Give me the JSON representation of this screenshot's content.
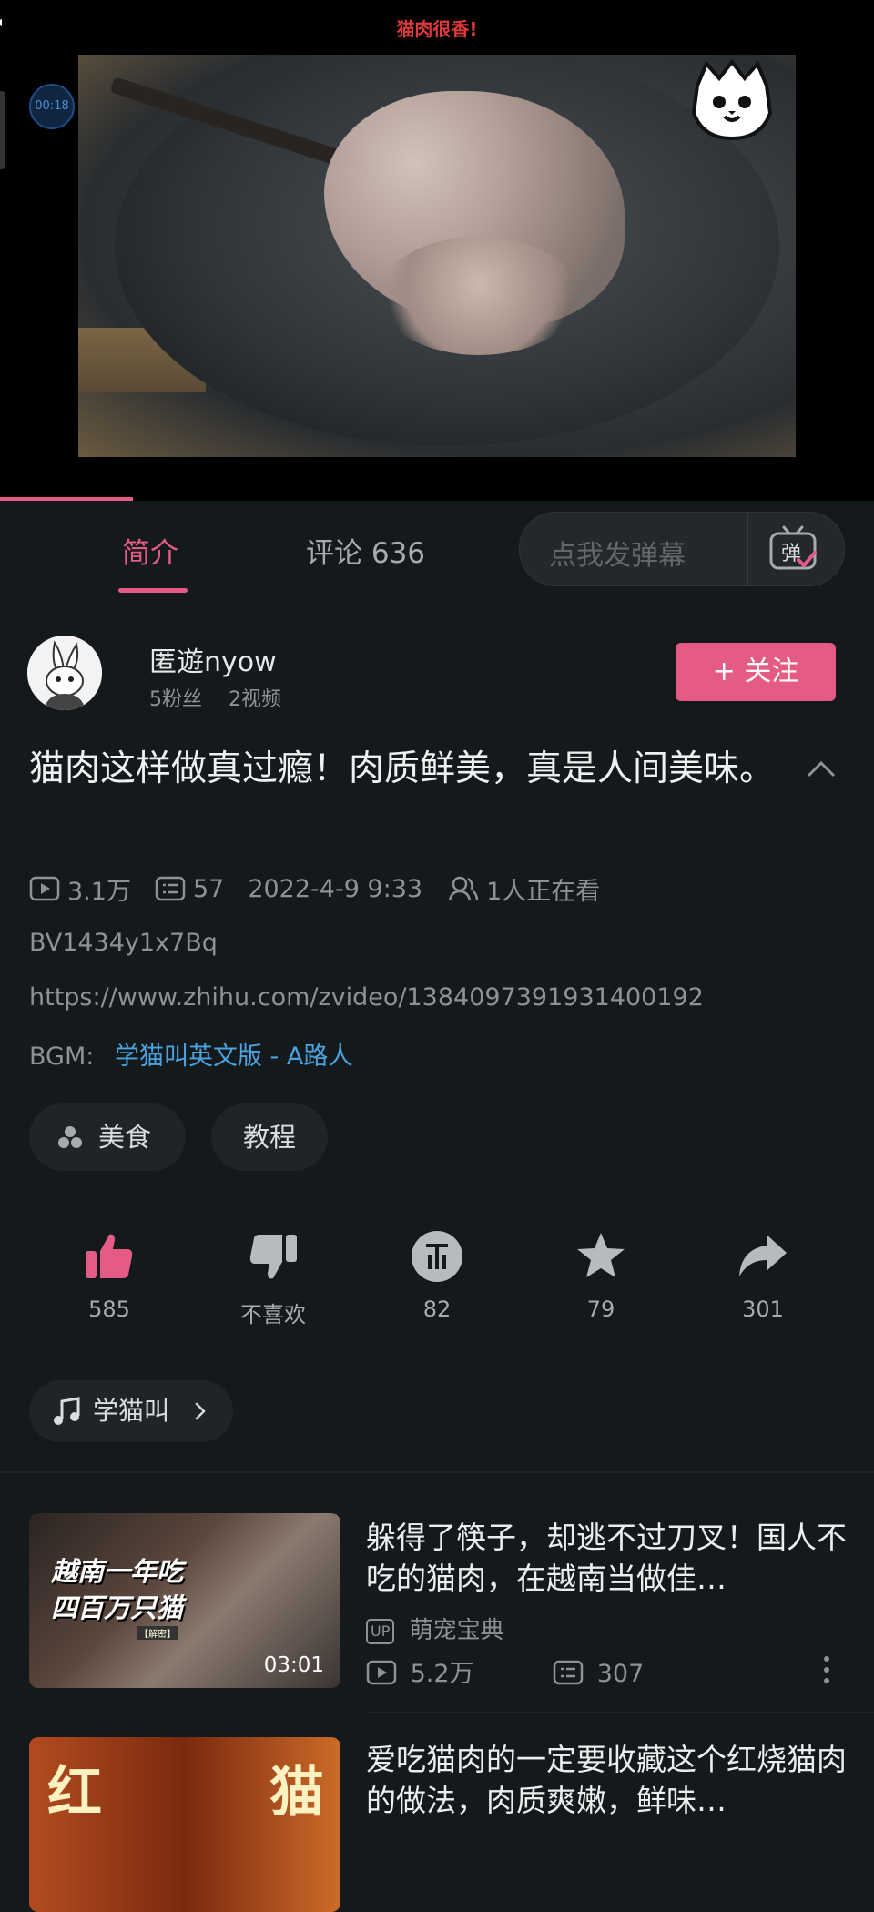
{
  "player": {
    "top_danmaku": "猫肉很香!",
    "time_badge": "00:18"
  },
  "tabs": {
    "intro": "简介",
    "comments": "评论 636",
    "danmaku_placeholder": "点我发弹幕",
    "danmaku_icon_glyph": "弹"
  },
  "uploader": {
    "name": "匿遊nyow",
    "stats": "5粉丝 　2视频",
    "follow_label": "+ 关注"
  },
  "video": {
    "title": "猫肉这样做真过瘾！肉质鲜美，真是人间美味。",
    "views": "3.1万",
    "danmaku_count": "57",
    "date": "2022-4-9 9:33",
    "watching": "1人正在看",
    "bvid": "BV1434y1x7Bq",
    "url": "https://www.zhihu.com/zvideo/1384097391931400192",
    "bgm_prefix": "BGM:",
    "bgm_link": "学猫叫英文版 - A路人"
  },
  "tags": {
    "food": "美食",
    "tutorial": "教程"
  },
  "actions": {
    "like": "585",
    "dislike": "不喜欢",
    "coin": "82",
    "favorite": "79",
    "share": "301"
  },
  "music": {
    "label": "学猫叫"
  },
  "recommendations": [
    {
      "title": "躲得了筷子，却逃不过刀叉！国人不吃的猫肉，在越南当做佳…",
      "thumb_text_1": "越南一年吃",
      "thumb_text_2": "四百万只猫",
      "thumb_label": "【解密】",
      "duration": "03:01",
      "up_badge": "UP",
      "uploader": "萌宠宝典",
      "views": "5.2万",
      "danmaku": "307"
    },
    {
      "title": "爱吃猫肉的一定要收藏这个红烧猫肉的做法，肉质爽嫩，鲜味…",
      "thumb_char_1": "红",
      "thumb_char_2": "猫"
    }
  ],
  "colors": {
    "accent": "#e45c86",
    "link": "#4aa3df",
    "background": "#14191c"
  }
}
